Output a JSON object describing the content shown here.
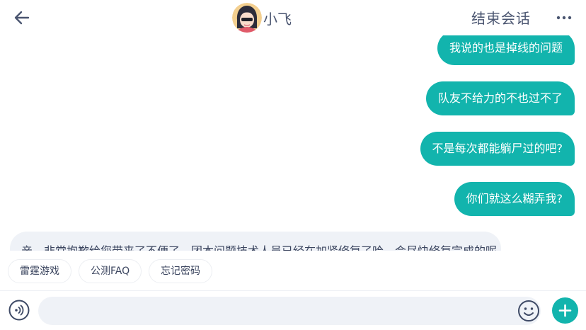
{
  "header": {
    "back_icon": "arrow-left-icon",
    "agent_name": "小飞",
    "end_chat_label": "结束会话",
    "more_icon": "more-dots-icon"
  },
  "messages": [
    {
      "side": "out",
      "text": "我说的也是掉线的问题"
    },
    {
      "side": "out",
      "text": "队友不给力的不也过不了"
    },
    {
      "side": "out",
      "text": "不是每次都能躺尸过的吧?"
    },
    {
      "side": "out",
      "text": "你们就这么糊弄我?"
    },
    {
      "side": "in",
      "text": "亲，非常抱歉给您带来了不便了，团本问题技术人员已经在加紧修复了哈，会尽快修复完成的呢"
    }
  ],
  "quick_replies": [
    "雷霆游戏",
    "公测FAQ",
    "忘记密码"
  ],
  "input": {
    "value": "",
    "placeholder": ""
  },
  "colors": {
    "accent": "#12b4ad",
    "incoming_bubble": "#eff2f7",
    "text": "#3e4a66"
  }
}
